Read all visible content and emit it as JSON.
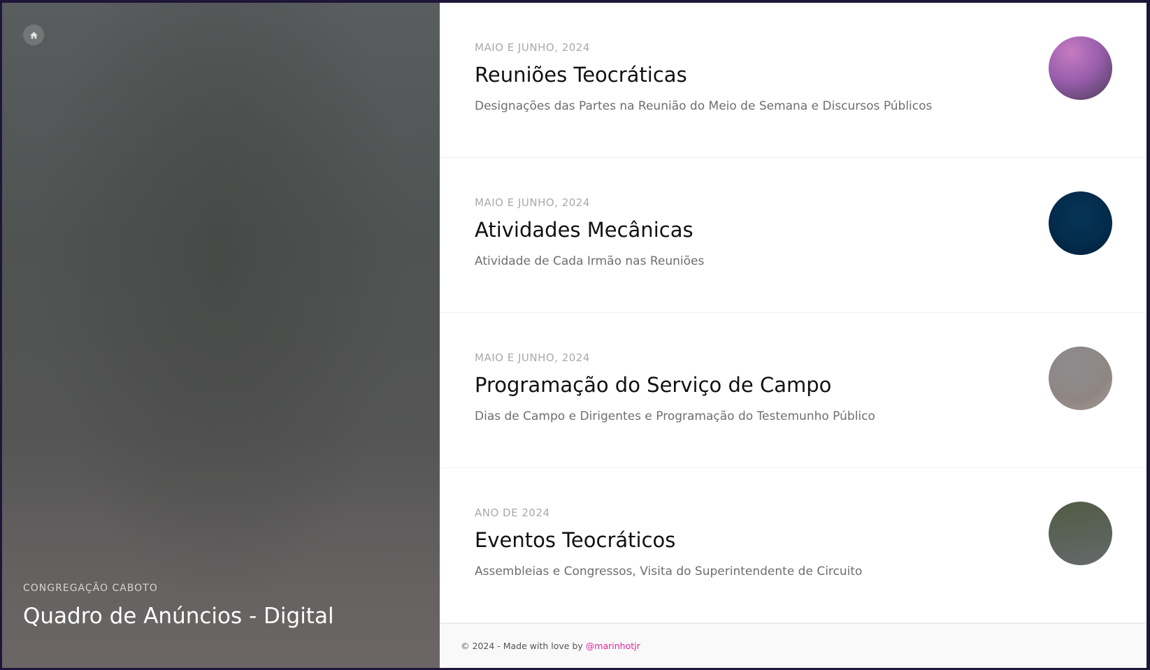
{
  "sidebar": {
    "home_icon": "home-icon",
    "congregation": "CONGREGAÇÃO CABOTO",
    "title": "Quadro de Anúncios - Digital"
  },
  "cards": [
    {
      "period": "MAIO E JUNHO, 2024",
      "title": "Reuniões Teocráticas",
      "description": "Designações das Partes na Reunião do Meio de Semana e Discursos Públicos"
    },
    {
      "period": "MAIO E JUNHO, 2024",
      "title": "Atividades Mecânicas",
      "description": "Atividade de Cada Irmão nas Reuniões"
    },
    {
      "period": "MAIO E JUNHO, 2024",
      "title": "Programação do Serviço de Campo",
      "description": "Dias de Campo e Dirigentes e Programação do Testemunho Público"
    },
    {
      "period": "ANO DE 2024",
      "title": "Eventos Teocráticos",
      "description": "Assembleias e Congressos, Visita do Superintendente de Circuito"
    }
  ],
  "footer": {
    "text": "© 2024 - Made with love by",
    "link": "@marinhotjr"
  },
  "colors": {
    "accent_link": "#e0249b",
    "background": "#1e1638"
  }
}
